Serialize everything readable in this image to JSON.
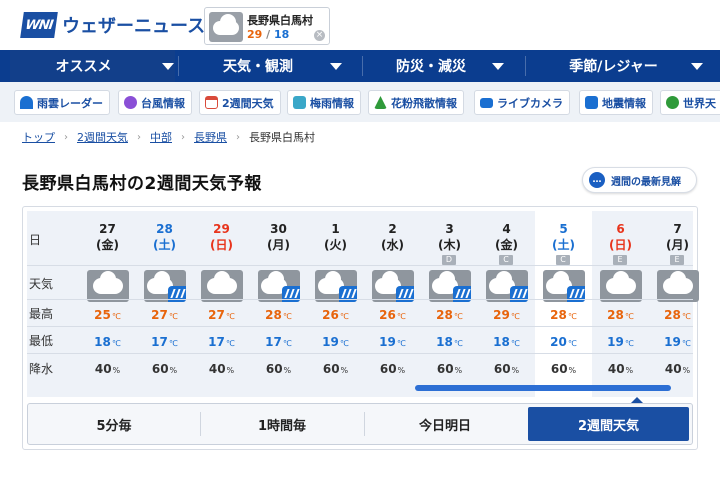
{
  "header": {
    "logo_mark": "WNI",
    "logo_text": "ウェザーニュース",
    "location_card": {
      "name": "長野県白馬村",
      "high": "29",
      "slash": "/",
      "low": "18"
    }
  },
  "nav": {
    "items": [
      {
        "label": "オススメ"
      },
      {
        "label": "天気・観測"
      },
      {
        "label": "防災・減災"
      },
      {
        "label": "季節/レジャー"
      }
    ]
  },
  "subnav": {
    "items": [
      {
        "label": "雨雲レーダー",
        "icon": "umbrella-icon",
        "color": "#1a6fd1"
      },
      {
        "label": "台風情報",
        "icon": "typhoon-icon",
        "color": "#8a4fd6"
      },
      {
        "label": "2週間天気",
        "icon": "calendar-icon",
        "color": "#d94a3a"
      },
      {
        "label": "梅雨情報",
        "icon": "rainy-season-icon",
        "color": "#3aa7c8"
      },
      {
        "label": "花粉飛散情報",
        "icon": "pollen-icon",
        "color": "#2f9a3a"
      },
      {
        "label": "ライブカメラ",
        "icon": "camera-icon",
        "color": "#1a6fd1"
      },
      {
        "label": "地震情報",
        "icon": "earthquake-icon",
        "color": "#1a6fd1"
      },
      {
        "label": "世界天",
        "icon": "globe-icon",
        "color": "#2f9a3a"
      }
    ]
  },
  "breadcrumb": [
    "トップ",
    "2週間天気",
    "中部",
    "長野県",
    "長野県白馬村"
  ],
  "page_title": "長野県白馬村の2週間天気予報",
  "latest_button": "週間の最新見解",
  "row_labels": {
    "day": "日",
    "weather": "天気",
    "high": "最高",
    "low": "最低",
    "precip": "降水"
  },
  "units": {
    "temp": "℃",
    "precip": "%"
  },
  "days": [
    {
      "date": "27",
      "weekday": "(金)",
      "type": "weekday",
      "icon": "cloudy",
      "rel": "",
      "high": "25",
      "low": "18",
      "precip": "40"
    },
    {
      "date": "28",
      "weekday": "(土)",
      "type": "sat",
      "icon": "cloudy-rain",
      "rel": "",
      "high": "27",
      "low": "17",
      "precip": "60"
    },
    {
      "date": "29",
      "weekday": "(日)",
      "type": "sun",
      "icon": "cloudy",
      "rel": "",
      "high": "27",
      "low": "17",
      "precip": "40"
    },
    {
      "date": "30",
      "weekday": "(月)",
      "type": "weekday",
      "icon": "cloudy-rain",
      "rel": "",
      "high": "28",
      "low": "17",
      "precip": "60"
    },
    {
      "date": "1",
      "weekday": "(火)",
      "type": "weekday",
      "icon": "cloudy-rain",
      "rel": "",
      "high": "26",
      "low": "19",
      "precip": "60"
    },
    {
      "date": "2",
      "weekday": "(水)",
      "type": "weekday",
      "icon": "cloudy-rain",
      "rel": "",
      "high": "26",
      "low": "19",
      "precip": "60"
    },
    {
      "date": "3",
      "weekday": "(木)",
      "type": "weekday",
      "icon": "cloudy-rain",
      "rel": "D",
      "high": "28",
      "low": "18",
      "precip": "60"
    },
    {
      "date": "4",
      "weekday": "(金)",
      "type": "weekday",
      "icon": "cloudy-rain",
      "rel": "C",
      "high": "29",
      "low": "18",
      "precip": "60"
    },
    {
      "date": "5",
      "weekday": "(土)",
      "type": "sat",
      "icon": "cloudy-rain",
      "rel": "C",
      "high": "28",
      "low": "20",
      "precip": "60"
    },
    {
      "date": "6",
      "weekday": "(日)",
      "type": "sun",
      "icon": "cloudy",
      "rel": "E",
      "high": "28",
      "low": "19",
      "precip": "40"
    },
    {
      "date": "7",
      "weekday": "(月)",
      "type": "weekday",
      "icon": "cloudy",
      "rel": "E",
      "high": "28",
      "low": "19",
      "precip": "40"
    }
  ],
  "tabs": [
    {
      "label": "5分毎"
    },
    {
      "label": "1時間毎"
    },
    {
      "label": "今日明日"
    },
    {
      "label": "2週間天気",
      "active": true
    }
  ],
  "colors": {
    "brand": "#1a4fa3",
    "nav_bg": "#0b3d8f",
    "high": "#e8640c",
    "low": "#1a6fd1",
    "sat": "#1a6fd1",
    "sun": "#e8341c"
  }
}
